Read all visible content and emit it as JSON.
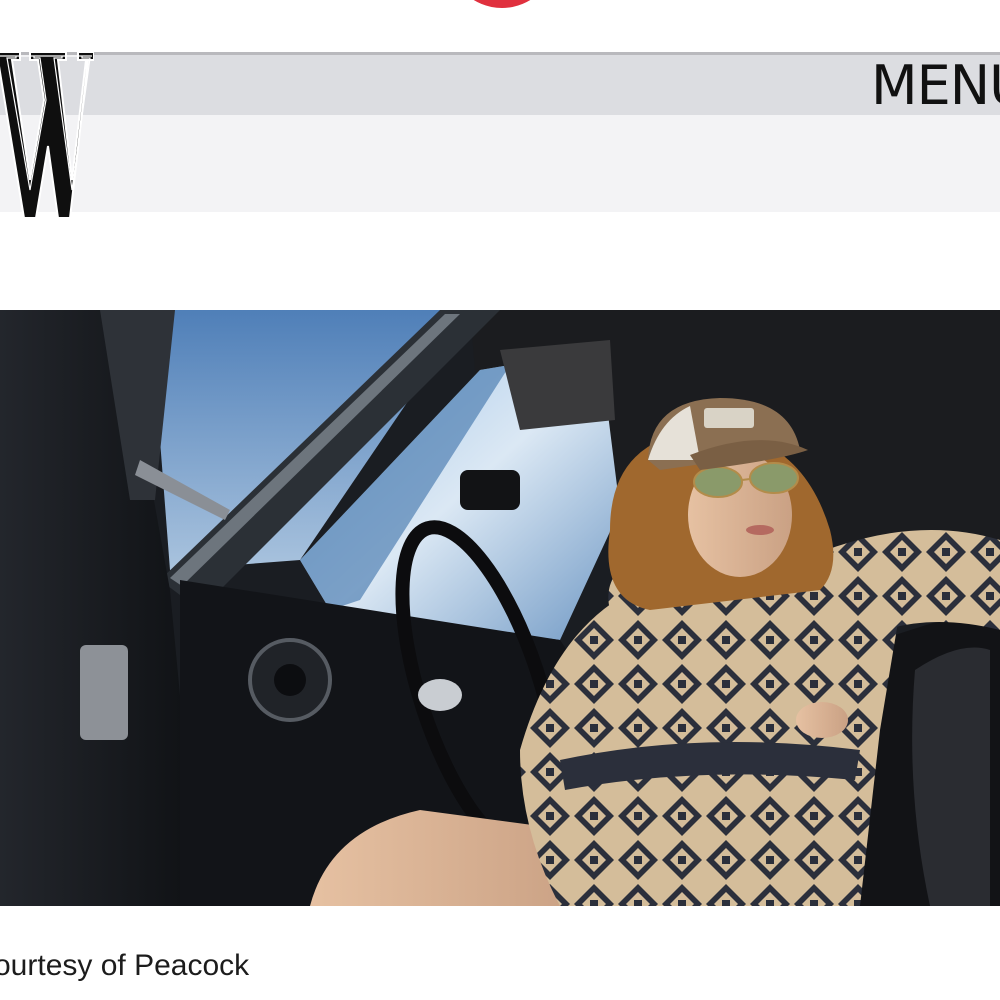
{
  "header": {
    "logo_text": "W",
    "menu_label": "MENU"
  },
  "hero": {
    "image_description": "woman in patterned cardigan and trucker cap on phone in vintage car",
    "caption": "ourtesy of Peacock"
  },
  "colors": {
    "accent_red": "#e0303e",
    "header_band": "#dcdde1",
    "header_lower": "#f3f3f5",
    "text": "#111111"
  }
}
